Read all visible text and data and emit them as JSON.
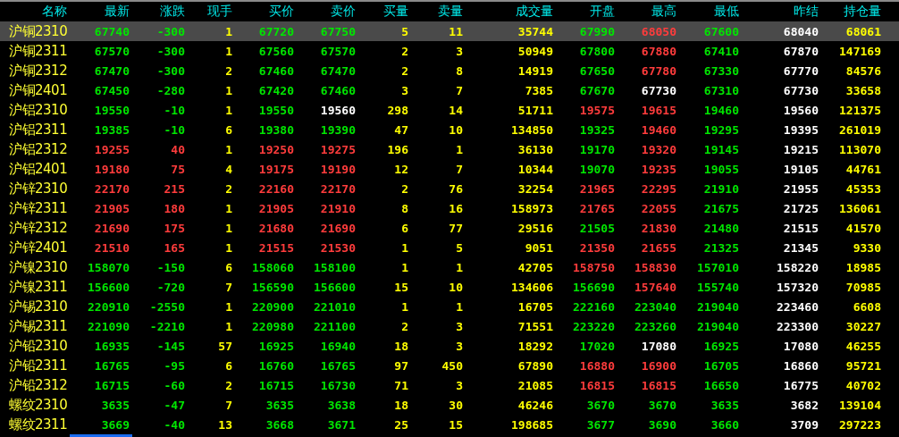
{
  "columns": [
    {
      "label": "名称",
      "kind": "name"
    },
    {
      "label": "最新",
      "kind": "price"
    },
    {
      "label": "涨跌",
      "kind": "price"
    },
    {
      "label": "现手",
      "kind": "count"
    },
    {
      "label": "买价",
      "kind": "price"
    },
    {
      "label": "卖价",
      "kind": "price"
    },
    {
      "label": "买量",
      "kind": "count"
    },
    {
      "label": "卖量",
      "kind": "count"
    },
    {
      "label": "成交量",
      "kind": "count"
    },
    {
      "label": "开盘",
      "kind": "price"
    },
    {
      "label": "最高",
      "kind": "price"
    },
    {
      "label": "最低",
      "kind": "price"
    },
    {
      "label": "昨结",
      "kind": "settle"
    },
    {
      "label": "持仓量",
      "kind": "count"
    }
  ],
  "rows": [
    {
      "selected": true,
      "cells": [
        "沪铜2310",
        {
          "value": "67740",
          "color": "#00e600"
        },
        {
          "value": "-300",
          "color": "#00e600"
        },
        "1",
        {
          "value": "67720",
          "color": "#00e600"
        },
        {
          "value": "67750",
          "color": "#00e600"
        },
        "5",
        "11",
        "35744",
        {
          "value": "67990",
          "color": "#00e600"
        },
        {
          "value": "68050",
          "color": "#ff3c3c"
        },
        {
          "value": "67600",
          "color": "#00e600"
        },
        "68040",
        "68061"
      ]
    },
    {
      "selected": false,
      "cells": [
        "沪铜2311",
        {
          "value": "67570",
          "color": "#00e600"
        },
        {
          "value": "-300",
          "color": "#00e600"
        },
        "1",
        {
          "value": "67560",
          "color": "#00e600"
        },
        {
          "value": "67570",
          "color": "#00e600"
        },
        "2",
        "3",
        "50949",
        {
          "value": "67800",
          "color": "#00e600"
        },
        {
          "value": "67880",
          "color": "#ff3c3c"
        },
        {
          "value": "67410",
          "color": "#00e600"
        },
        "67870",
        "147169"
      ]
    },
    {
      "selected": false,
      "cells": [
        "沪铜2312",
        {
          "value": "67470",
          "color": "#00e600"
        },
        {
          "value": "-300",
          "color": "#00e600"
        },
        "2",
        {
          "value": "67460",
          "color": "#00e600"
        },
        {
          "value": "67470",
          "color": "#00e600"
        },
        "2",
        "8",
        "14919",
        {
          "value": "67650",
          "color": "#00e600"
        },
        {
          "value": "67780",
          "color": "#ff3c3c"
        },
        {
          "value": "67330",
          "color": "#00e600"
        },
        "67770",
        "84576"
      ]
    },
    {
      "selected": false,
      "cells": [
        "沪铜2401",
        {
          "value": "67450",
          "color": "#00e600"
        },
        {
          "value": "-280",
          "color": "#00e600"
        },
        "1",
        {
          "value": "67420",
          "color": "#00e600"
        },
        {
          "value": "67460",
          "color": "#00e600"
        },
        "3",
        "7",
        "7385",
        {
          "value": "67670",
          "color": "#00e600"
        },
        {
          "value": "67730",
          "color": "#ffffff"
        },
        {
          "value": "67310",
          "color": "#00e600"
        },
        "67730",
        "33658"
      ]
    },
    {
      "selected": false,
      "cells": [
        "沪铝2310",
        {
          "value": "19550",
          "color": "#00e600"
        },
        {
          "value": "-10",
          "color": "#00e600"
        },
        "1",
        {
          "value": "19550",
          "color": "#00e600"
        },
        {
          "value": "19560",
          "color": "#ffffff"
        },
        "298",
        "14",
        "51711",
        {
          "value": "19575",
          "color": "#ff3c3c"
        },
        {
          "value": "19615",
          "color": "#ff3c3c"
        },
        {
          "value": "19460",
          "color": "#00e600"
        },
        "19560",
        "121375"
      ]
    },
    {
      "selected": false,
      "cells": [
        "沪铝2311",
        {
          "value": "19385",
          "color": "#00e600"
        },
        {
          "value": "-10",
          "color": "#00e600"
        },
        "6",
        {
          "value": "19380",
          "color": "#00e600"
        },
        {
          "value": "19390",
          "color": "#00e600"
        },
        "47",
        "10",
        "134850",
        {
          "value": "19325",
          "color": "#00e600"
        },
        {
          "value": "19460",
          "color": "#ff3c3c"
        },
        {
          "value": "19295",
          "color": "#00e600"
        },
        "19395",
        "261019"
      ]
    },
    {
      "selected": false,
      "cells": [
        "沪铝2312",
        {
          "value": "19255",
          "color": "#ff3c3c"
        },
        {
          "value": "40",
          "color": "#ff3c3c"
        },
        "1",
        {
          "value": "19250",
          "color": "#ff3c3c"
        },
        {
          "value": "19275",
          "color": "#ff3c3c"
        },
        "196",
        "1",
        "36130",
        {
          "value": "19170",
          "color": "#00e600"
        },
        {
          "value": "19320",
          "color": "#ff3c3c"
        },
        {
          "value": "19145",
          "color": "#00e600"
        },
        "19215",
        "113070"
      ]
    },
    {
      "selected": false,
      "cells": [
        "沪铝2401",
        {
          "value": "19180",
          "color": "#ff3c3c"
        },
        {
          "value": "75",
          "color": "#ff3c3c"
        },
        "4",
        {
          "value": "19175",
          "color": "#ff3c3c"
        },
        {
          "value": "19190",
          "color": "#ff3c3c"
        },
        "12",
        "7",
        "10344",
        {
          "value": "19070",
          "color": "#00e600"
        },
        {
          "value": "19235",
          "color": "#ff3c3c"
        },
        {
          "value": "19055",
          "color": "#00e600"
        },
        "19105",
        "44761"
      ]
    },
    {
      "selected": false,
      "cells": [
        "沪锌2310",
        {
          "value": "22170",
          "color": "#ff3c3c"
        },
        {
          "value": "215",
          "color": "#ff3c3c"
        },
        "2",
        {
          "value": "22160",
          "color": "#ff3c3c"
        },
        {
          "value": "22170",
          "color": "#ff3c3c"
        },
        "2",
        "76",
        "32254",
        {
          "value": "21965",
          "color": "#ff3c3c"
        },
        {
          "value": "22295",
          "color": "#ff3c3c"
        },
        {
          "value": "21910",
          "color": "#00e600"
        },
        "21955",
        "45353"
      ]
    },
    {
      "selected": false,
      "cells": [
        "沪锌2311",
        {
          "value": "21905",
          "color": "#ff3c3c"
        },
        {
          "value": "180",
          "color": "#ff3c3c"
        },
        "1",
        {
          "value": "21905",
          "color": "#ff3c3c"
        },
        {
          "value": "21910",
          "color": "#ff3c3c"
        },
        "8",
        "16",
        "158973",
        {
          "value": "21765",
          "color": "#ff3c3c"
        },
        {
          "value": "22055",
          "color": "#ff3c3c"
        },
        {
          "value": "21675",
          "color": "#00e600"
        },
        "21725",
        "136061"
      ]
    },
    {
      "selected": false,
      "cells": [
        "沪锌2312",
        {
          "value": "21690",
          "color": "#ff3c3c"
        },
        {
          "value": "175",
          "color": "#ff3c3c"
        },
        "1",
        {
          "value": "21680",
          "color": "#ff3c3c"
        },
        {
          "value": "21690",
          "color": "#ff3c3c"
        },
        "6",
        "77",
        "29516",
        {
          "value": "21505",
          "color": "#00e600"
        },
        {
          "value": "21830",
          "color": "#ff3c3c"
        },
        {
          "value": "21480",
          "color": "#00e600"
        },
        "21515",
        "41570"
      ]
    },
    {
      "selected": false,
      "cells": [
        "沪锌2401",
        {
          "value": "21510",
          "color": "#ff3c3c"
        },
        {
          "value": "165",
          "color": "#ff3c3c"
        },
        "1",
        {
          "value": "21515",
          "color": "#ff3c3c"
        },
        {
          "value": "21530",
          "color": "#ff3c3c"
        },
        "1",
        "5",
        "9051",
        {
          "value": "21350",
          "color": "#ff3c3c"
        },
        {
          "value": "21655",
          "color": "#ff3c3c"
        },
        {
          "value": "21325",
          "color": "#00e600"
        },
        "21345",
        "9330"
      ]
    },
    {
      "selected": false,
      "cells": [
        "沪镍2310",
        {
          "value": "158070",
          "color": "#00e600"
        },
        {
          "value": "-150",
          "color": "#00e600"
        },
        "6",
        {
          "value": "158060",
          "color": "#00e600"
        },
        {
          "value": "158100",
          "color": "#00e600"
        },
        "1",
        "1",
        "42705",
        {
          "value": "158750",
          "color": "#ff3c3c"
        },
        {
          "value": "158830",
          "color": "#ff3c3c"
        },
        {
          "value": "157010",
          "color": "#00e600"
        },
        "158220",
        "18985"
      ]
    },
    {
      "selected": false,
      "cells": [
        "沪镍2311",
        {
          "value": "156600",
          "color": "#00e600"
        },
        {
          "value": "-720",
          "color": "#00e600"
        },
        "7",
        {
          "value": "156590",
          "color": "#00e600"
        },
        {
          "value": "156600",
          "color": "#00e600"
        },
        "15",
        "10",
        "134606",
        {
          "value": "156690",
          "color": "#00e600"
        },
        {
          "value": "157640",
          "color": "#ff3c3c"
        },
        {
          "value": "155740",
          "color": "#00e600"
        },
        "157320",
        "70985"
      ]
    },
    {
      "selected": false,
      "cells": [
        "沪锡2310",
        {
          "value": "220910",
          "color": "#00e600"
        },
        {
          "value": "-2550",
          "color": "#00e600"
        },
        "1",
        {
          "value": "220900",
          "color": "#00e600"
        },
        {
          "value": "221010",
          "color": "#00e600"
        },
        "1",
        "1",
        "16705",
        {
          "value": "222160",
          "color": "#00e600"
        },
        {
          "value": "223040",
          "color": "#00e600"
        },
        {
          "value": "219040",
          "color": "#00e600"
        },
        "223460",
        "6608"
      ]
    },
    {
      "selected": false,
      "cells": [
        "沪锡2311",
        {
          "value": "221090",
          "color": "#00e600"
        },
        {
          "value": "-2210",
          "color": "#00e600"
        },
        "1",
        {
          "value": "220980",
          "color": "#00e600"
        },
        {
          "value": "221100",
          "color": "#00e600"
        },
        "2",
        "3",
        "71551",
        {
          "value": "223220",
          "color": "#00e600"
        },
        {
          "value": "223260",
          "color": "#00e600"
        },
        {
          "value": "219040",
          "color": "#00e600"
        },
        "223300",
        "30227"
      ]
    },
    {
      "selected": false,
      "cells": [
        "沪铅2310",
        {
          "value": "16935",
          "color": "#00e600"
        },
        {
          "value": "-145",
          "color": "#00e600"
        },
        "57",
        {
          "value": "16925",
          "color": "#00e600"
        },
        {
          "value": "16940",
          "color": "#00e600"
        },
        "18",
        "3",
        "18292",
        {
          "value": "17020",
          "color": "#00e600"
        },
        {
          "value": "17080",
          "color": "#ffffff"
        },
        {
          "value": "16925",
          "color": "#00e600"
        },
        "17080",
        "46255"
      ]
    },
    {
      "selected": false,
      "cells": [
        "沪铅2311",
        {
          "value": "16765",
          "color": "#00e600"
        },
        {
          "value": "-95",
          "color": "#00e600"
        },
        "6",
        {
          "value": "16760",
          "color": "#00e600"
        },
        {
          "value": "16765",
          "color": "#00e600"
        },
        "97",
        "450",
        "67890",
        {
          "value": "16880",
          "color": "#ff3c3c"
        },
        {
          "value": "16900",
          "color": "#ff3c3c"
        },
        {
          "value": "16705",
          "color": "#00e600"
        },
        "16860",
        "95721"
      ]
    },
    {
      "selected": false,
      "cells": [
        "沪铅2312",
        {
          "value": "16715",
          "color": "#00e600"
        },
        {
          "value": "-60",
          "color": "#00e600"
        },
        "2",
        {
          "value": "16715",
          "color": "#00e600"
        },
        {
          "value": "16730",
          "color": "#00e600"
        },
        "71",
        "3",
        "21085",
        {
          "value": "16815",
          "color": "#ff3c3c"
        },
        {
          "value": "16815",
          "color": "#ff3c3c"
        },
        {
          "value": "16650",
          "color": "#00e600"
        },
        "16775",
        "40702"
      ]
    },
    {
      "selected": false,
      "cells": [
        "螺纹2310",
        {
          "value": "3635",
          "color": "#00e600"
        },
        {
          "value": "-47",
          "color": "#00e600"
        },
        "7",
        {
          "value": "3635",
          "color": "#00e600"
        },
        {
          "value": "3638",
          "color": "#00e600"
        },
        "18",
        "30",
        "46246",
        {
          "value": "3670",
          "color": "#00e600"
        },
        {
          "value": "3670",
          "color": "#00e600"
        },
        {
          "value": "3635",
          "color": "#00e600"
        },
        "3682",
        "139104"
      ]
    },
    {
      "selected": false,
      "cells": [
        "螺纹2311",
        {
          "value": "3669",
          "color": "#00e600"
        },
        {
          "value": "-40",
          "color": "#00e600"
        },
        "13",
        {
          "value": "3668",
          "color": "#00e600"
        },
        {
          "value": "3671",
          "color": "#00e600"
        },
        "25",
        "15",
        "198685",
        {
          "value": "3677",
          "color": "#00e600"
        },
        {
          "value": "3690",
          "color": "#00e600"
        },
        {
          "value": "3660",
          "color": "#00e600"
        },
        "3709",
        "297223"
      ]
    }
  ]
}
